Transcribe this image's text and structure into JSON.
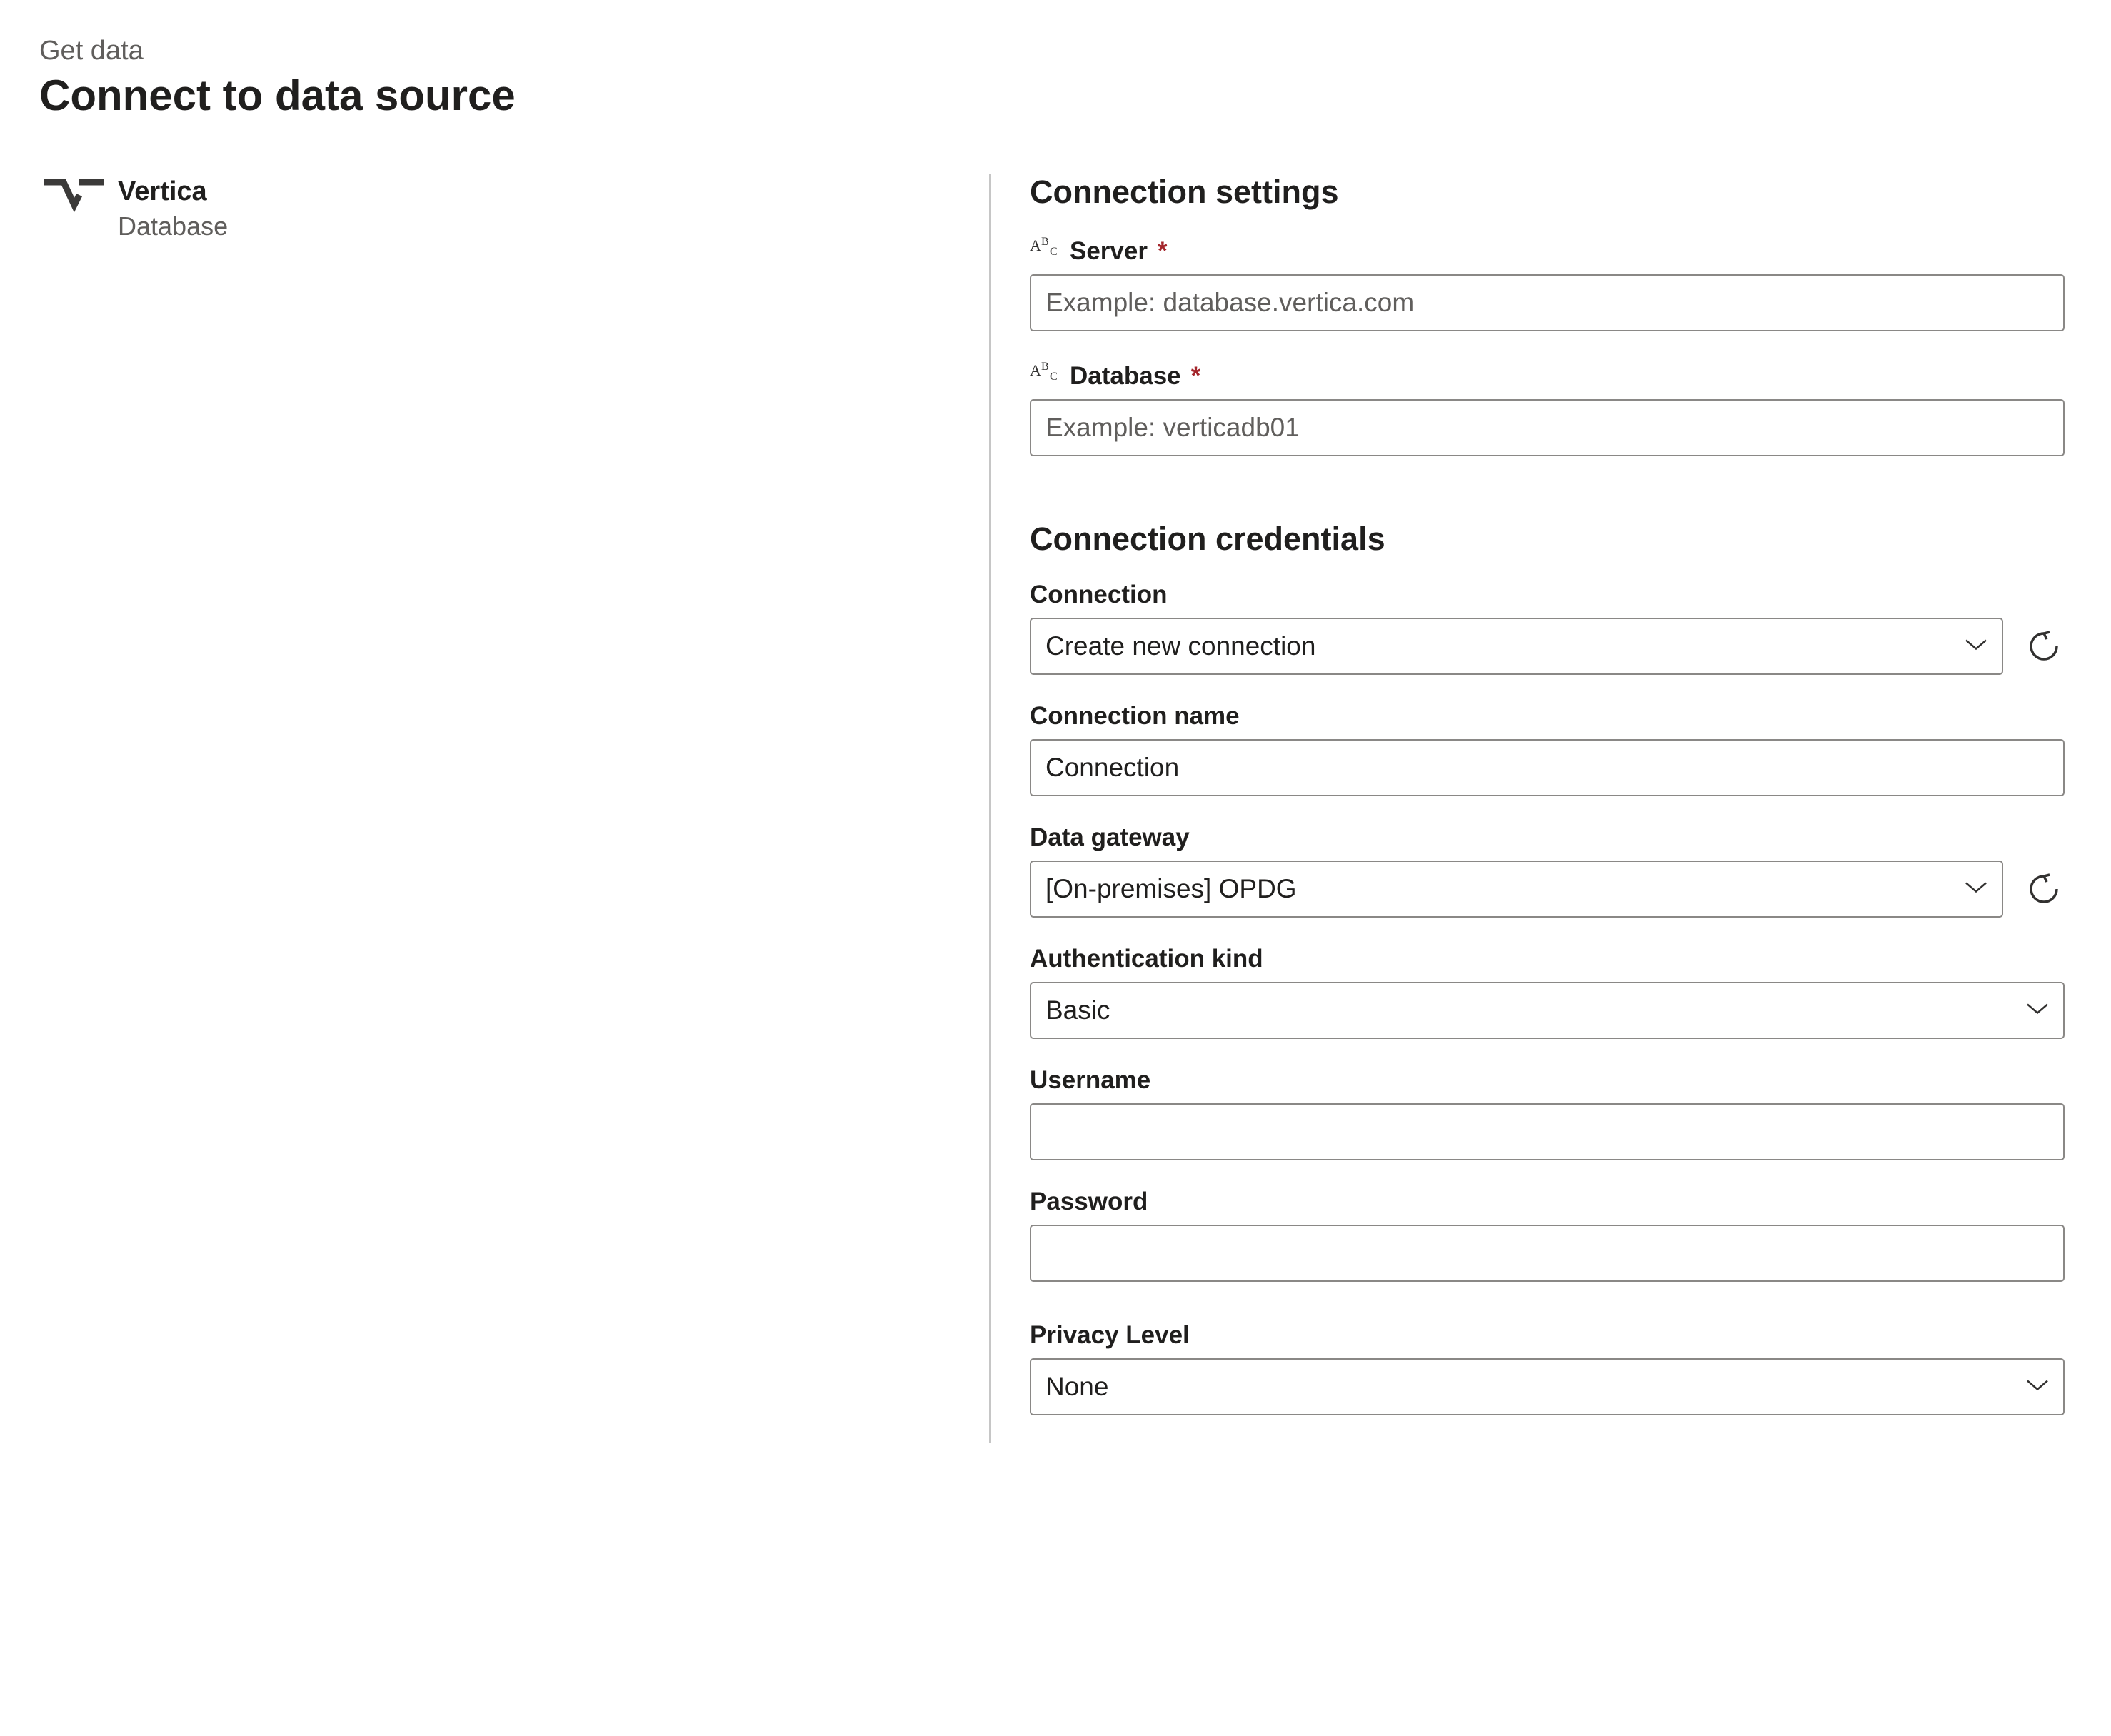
{
  "header": {
    "breadcrumb": "Get data",
    "title": "Connect to data source"
  },
  "connector": {
    "name": "Vertica",
    "category": "Database"
  },
  "settings": {
    "section_title": "Connection settings",
    "server": {
      "label": "Server",
      "placeholder": "Example: database.vertica.com",
      "value": "",
      "required": true
    },
    "database": {
      "label": "Database",
      "placeholder": "Example: verticadb01",
      "value": "",
      "required": true
    }
  },
  "credentials": {
    "section_title": "Connection credentials",
    "connection": {
      "label": "Connection",
      "value": "Create new connection"
    },
    "connection_name": {
      "label": "Connection name",
      "value": "Connection"
    },
    "data_gateway": {
      "label": "Data gateway",
      "value": "[On-premises] OPDG"
    },
    "auth_kind": {
      "label": "Authentication kind",
      "value": "Basic"
    },
    "username": {
      "label": "Username",
      "value": ""
    },
    "password": {
      "label": "Password",
      "value": ""
    },
    "privacy_level": {
      "label": "Privacy Level",
      "value": "None"
    }
  }
}
